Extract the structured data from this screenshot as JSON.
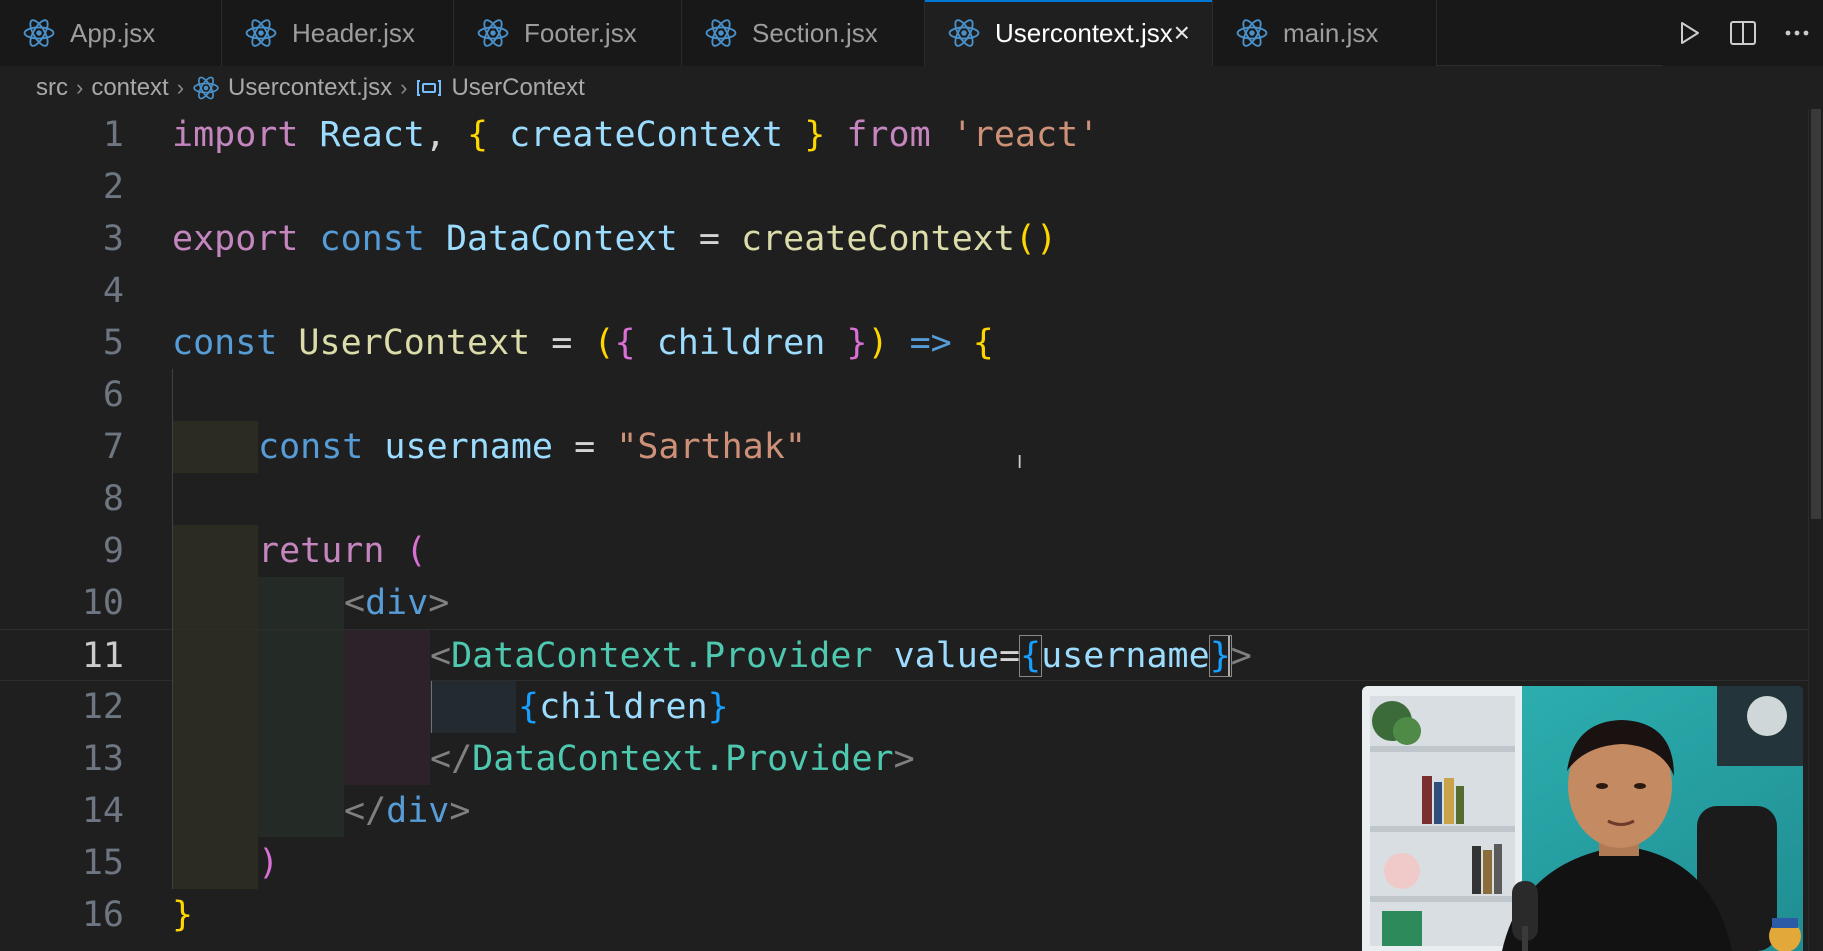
{
  "tabs": [
    {
      "label": "App.jsx",
      "active": false
    },
    {
      "label": "Header.jsx",
      "active": false
    },
    {
      "label": "Footer.jsx",
      "active": false
    },
    {
      "label": "Section.jsx",
      "active": false
    },
    {
      "label": "Usercontext.jsx",
      "active": true
    },
    {
      "label": "main.jsx",
      "active": false
    }
  ],
  "tab_close_icon": "×",
  "tab_actions": [
    "run-icon",
    "split-editor-icon",
    "more-actions-icon"
  ],
  "breadcrumb": {
    "items": [
      "src",
      "context",
      "Usercontext.jsx",
      "UserContext"
    ]
  },
  "editor": {
    "current_line": 11,
    "line_numbers": [
      "1",
      "2",
      "3",
      "4",
      "5",
      "6",
      "7",
      "8",
      "9",
      "10",
      "11",
      "12",
      "13",
      "14",
      "15",
      "16"
    ],
    "tokens": {
      "l1": [
        "import",
        " React",
        ",",
        " {",
        " createContext",
        " }",
        " from",
        " 'react'"
      ],
      "l3": [
        "export",
        " const",
        " DataContext",
        " =",
        " createContext",
        "()"
      ],
      "l5": [
        "const",
        " UserContext",
        " =",
        " (",
        "{",
        " children",
        " }",
        ")",
        " =>",
        " {"
      ],
      "l7": [
        "const",
        " username",
        " =",
        " \"Sarthak\""
      ],
      "l9": [
        "return",
        " ("
      ],
      "l10": [
        "<",
        "div",
        ">"
      ],
      "l11": [
        "<",
        "DataContext.Provider",
        " value",
        "=",
        "{",
        "username",
        "}",
        ">"
      ],
      "l12": [
        "{",
        "children",
        "}"
      ],
      "l13": [
        "</",
        "DataContext.Provider",
        ">"
      ],
      "l14": [
        "</",
        "div",
        ">"
      ],
      "l15": [
        ")"
      ],
      "l16": [
        "}"
      ]
    }
  },
  "colors": {
    "editor_bg": "#1f1f1f",
    "tab_bar_bg": "#181818",
    "keyword_pink": "#c586c0",
    "keyword_blue": "#569cd6",
    "variable": "#9cdcfe",
    "function": "#dcdcaa",
    "string": "#ce9178",
    "bracket_gold": "#ffd700",
    "bracket_orchid": "#da70d6",
    "bracket_blue": "#179fff",
    "active_tab_accent": "#0078d4"
  }
}
